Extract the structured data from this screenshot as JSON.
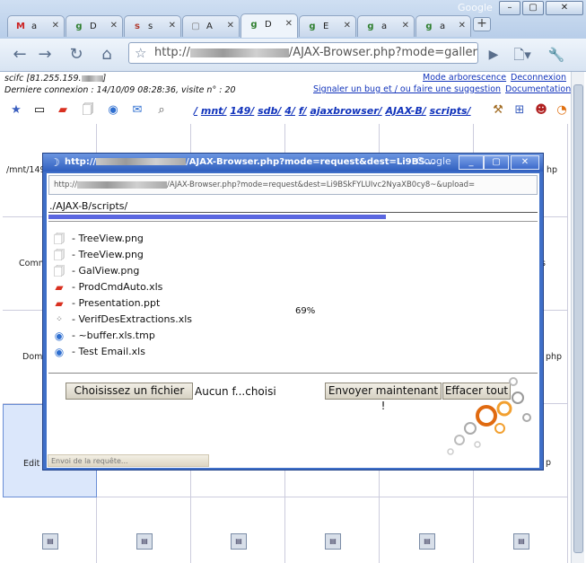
{
  "browser": {
    "brand": "Google",
    "tabs": [
      {
        "label": "a",
        "favicon": "M",
        "color": "#cc2222"
      },
      {
        "label": "D",
        "favicon": "g",
        "color": "#2f7f2f"
      },
      {
        "label": "s",
        "favicon": "s",
        "color": "#b03a2e"
      },
      {
        "label": "A",
        "favicon": "▢",
        "color": "#777777"
      },
      {
        "label": "D",
        "favicon": "g",
        "color": "#2f7f2f"
      },
      {
        "label": "E",
        "favicon": "g",
        "color": "#2f7f2f"
      },
      {
        "label": "a",
        "favicon": "g",
        "color": "#2f7f2f"
      },
      {
        "label": "a",
        "favicon": "g",
        "color": "#2f7f2f"
      }
    ],
    "url_prefix": "http://",
    "url_suffix": "/AJAX-Browser.php?mode=gallerie&raci"
  },
  "header": {
    "user_line": "scifc [81.255.159.",
    "last_login": "Derniere connexion : 14/10/09 08:28:36, visite n° : 20",
    "links": {
      "tree_mode": "Mode arborescence",
      "logout": "Deconnexion",
      "report_bug": "Signaler un bug et / ou faire une suggestion",
      "docs": "Documentation"
    }
  },
  "path": [
    "/",
    "mnt/",
    "149/",
    "sdb/",
    "4/",
    "f/",
    "ajaxbrowser/",
    "AJAX-B/",
    "scripts/"
  ],
  "grid": {
    "labels": [
      "/mnt/149",
      "Comm",
      "Dom",
      "Edit"
    ],
    "right_labels": [
      "hp",
      "s",
      "php",
      "p"
    ]
  },
  "popup": {
    "title_prefix": "http://",
    "title_suffix": "/AJAX-Browser.php?mode=request&dest=Li9BS...",
    "brand": "Google",
    "url_prefix": "http://",
    "url_suffix": "/AJAX-Browser.php?mode=request&dest=Li9BSkFYLUIvc2NyaXB0cy8~&upload=",
    "current_path": "./AJAX-B/scripts/",
    "progress_pct": 69,
    "progress_text": "69%",
    "files": [
      {
        "name": " - TreeView.png",
        "icon": "image-file-icon"
      },
      {
        "name": " - TreeView.png",
        "icon": "image-file-icon"
      },
      {
        "name": " - GalView.png",
        "icon": "image-file-icon"
      },
      {
        "name": " - ProdCmdAuto.xls",
        "icon": "eraser-icon"
      },
      {
        "name": " - Presentation.ppt",
        "icon": "eraser-icon"
      },
      {
        "name": " - VerifDesExtractions.xls",
        "icon": "loading-spinner-icon"
      },
      {
        "name": " - ~buffer.xls.tmp",
        "icon": "globe-file-icon"
      },
      {
        "name": " - Test Email.xls",
        "icon": "globe-file-icon"
      }
    ],
    "choose_file": "Choisissez un fichier",
    "no_file": "Aucun f...choisi",
    "send_now": "Envoyer maintenant !",
    "clear_all": "Effacer tout",
    "status": "Envoi de la requête..."
  }
}
